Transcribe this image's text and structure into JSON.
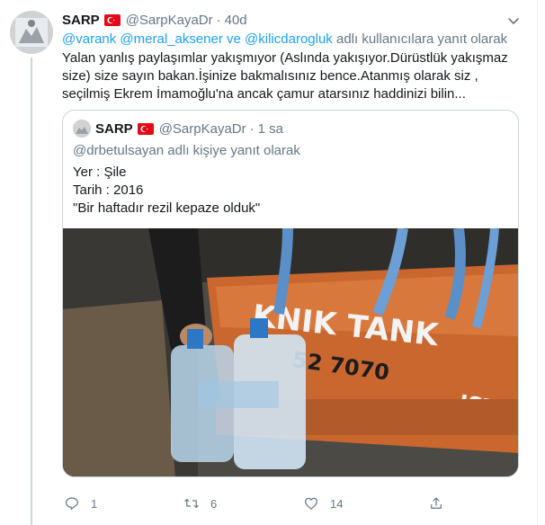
{
  "tweet": {
    "name": "SARP",
    "handle": "@SarpKayaDr",
    "separator": "·",
    "time": "40d",
    "reply_mentions": "@varank @meral_aksener ve @kilicdarogluk",
    "reply_suffix": "adlı kullanıcılara yanıt olarak",
    "text": "Yalan yanlış paylaşımlar yakışmıyor (Aslında yakışıyor.Dürüstlük yakışmaz size) size sayın bakan.İşinize bakmalısınız bence.Atanmış olarak siz , seçilmiş Ekrem İmamoğlu'na ancak çamur atarsınız haddinizi bilin..."
  },
  "quoted": {
    "name": "SARP",
    "handle": "@SarpKayaDr",
    "separator": "·",
    "time": "1 sa",
    "reply_mention": "@drbetulsayan",
    "reply_suffix": "adlı kişiye yanıt olarak",
    "lines": [
      "Yer : Şile",
      "Tarih : 2016",
      "\"Bir haftadır rezil kepaze olduk\""
    ],
    "media_text": [
      "KNIK TANK",
      "52 7070",
      "ISTA"
    ]
  },
  "actions": {
    "reply_count": "1",
    "retweet_count": "6",
    "like_count": "14"
  },
  "colors": {
    "link": "#1da1f2",
    "muted": "#657786",
    "flag_red": "#e30a17",
    "border": "#ccd6dd"
  },
  "icons": [
    "turkish-flag-icon",
    "chevron-down-icon",
    "reply-icon",
    "retweet-icon",
    "like-icon",
    "share-icon"
  ]
}
